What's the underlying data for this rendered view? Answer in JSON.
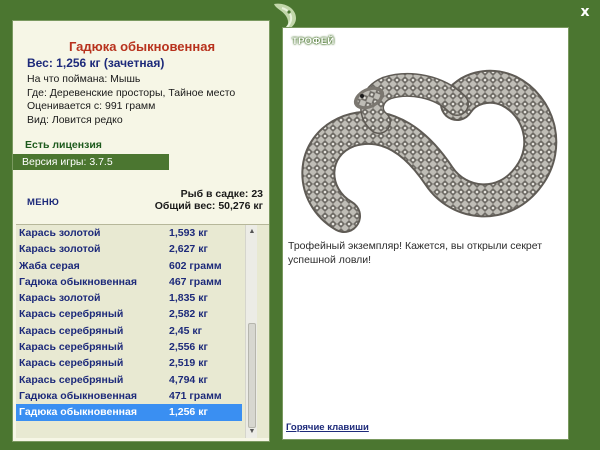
{
  "window": {
    "close_label": "x"
  },
  "catch": {
    "name": "Гадюка обыкновенная",
    "weight_title": "Вес: 1,256 кг (зачетная)",
    "bait_line": "На что поймана: Мышь",
    "place_line": "Где: Деревенские просторы, Тайное место",
    "value_line": "Оценивается с: 991 грамм",
    "kind_line": "Вид: Ловится редко"
  },
  "license_label": "Есть лицензия",
  "version_label": "Версия игры: 3.7.5",
  "menu_label": "МЕНЮ",
  "stats": {
    "fish_in_cage": "Рыб в садке: 23",
    "total_weight": "Общий вес: 50,276 кг"
  },
  "catch_list": [
    {
      "name": "Карась золотой",
      "weight": "1,593 кг"
    },
    {
      "name": "Карась золотой",
      "weight": "2,627 кг"
    },
    {
      "name": "Жаба серая",
      "weight": "602 грамм"
    },
    {
      "name": "Гадюка обыкновенная",
      "weight": "467 грамм"
    },
    {
      "name": "Карась золотой",
      "weight": "1,835 кг"
    },
    {
      "name": "Карась серебряный",
      "weight": "2,582 кг"
    },
    {
      "name": "Карась серебряный",
      "weight": "2,45 кг"
    },
    {
      "name": "Карась серебряный",
      "weight": "2,556 кг"
    },
    {
      "name": "Карась серебряный",
      "weight": "2,519 кг"
    },
    {
      "name": "Карась серебряный",
      "weight": "4,794 кг"
    },
    {
      "name": "Гадюка обыкновенная",
      "weight": "471 грамм"
    },
    {
      "name": "Гадюка обыкновенная",
      "weight": "1,256 кг",
      "selected": true
    }
  ],
  "trophy": {
    "label": "ТРОФЕЙ",
    "text": "Трофейный экземпляр! Кажется, вы открыли секрет успешной ловли!"
  },
  "hotkeys_label": "Горячие клавиши",
  "colors": {
    "frame": "#4b7630",
    "panel": "#f6f6e6",
    "list_bg": "#e8e9d2",
    "fish_name": "#b8321d",
    "list_text": "#1d2a7a",
    "selected": "#3a8ff2"
  }
}
